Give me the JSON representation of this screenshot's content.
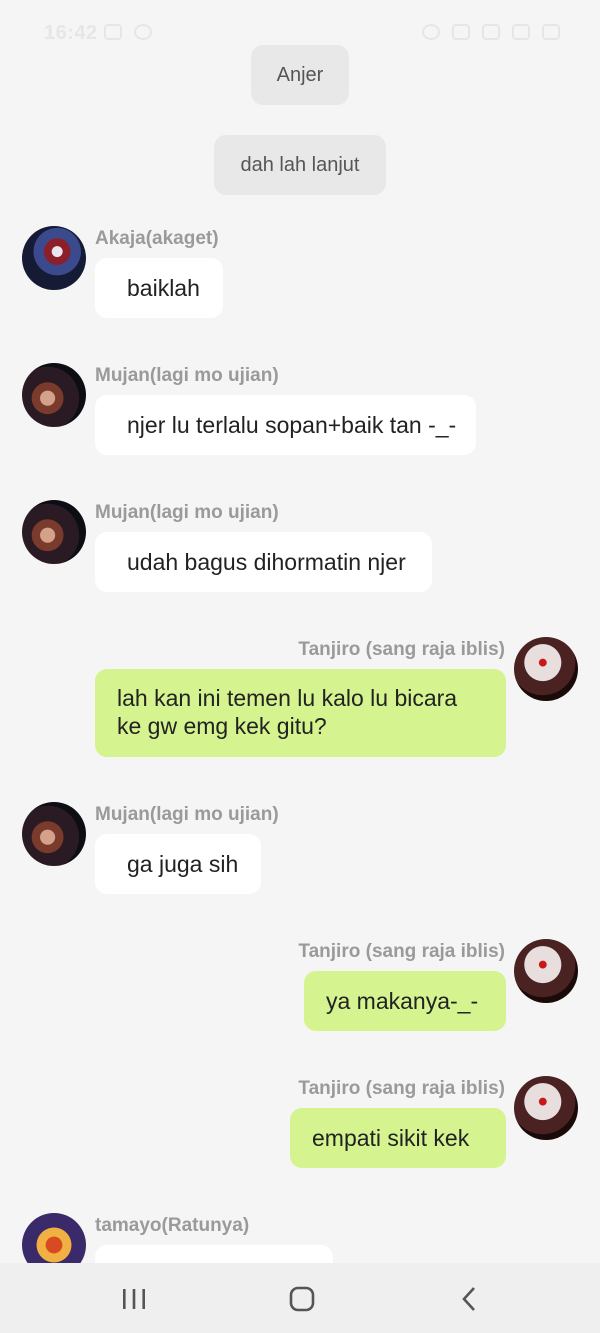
{
  "status_bar": {
    "time": "16:42"
  },
  "system_messages": [
    {
      "text": "Anjer"
    },
    {
      "text": "dah lah lanjut"
    }
  ],
  "messages": [
    {
      "sender": "Akaja(akaget)",
      "text": "baiklah",
      "direction": "in"
    },
    {
      "sender": "Mujan(lagi mo ujian)",
      "text": "njer lu terlalu sopan+baik tan -_-",
      "direction": "in"
    },
    {
      "sender": "Mujan(lagi mo ujian)",
      "text": "udah bagus dihormatin njer",
      "direction": "in"
    },
    {
      "sender": "Tanjiro (sang raja iblis)",
      "text": "lah kan ini temen lu kalo lu bicara ke gw emg kek gitu?",
      "direction": "out"
    },
    {
      "sender": "Mujan(lagi mo ujian)",
      "text": "ga juga sih",
      "direction": "in"
    },
    {
      "sender": "Tanjiro (sang raja iblis)",
      "text": "ya makanya-_-",
      "direction": "out"
    },
    {
      "sender": "Tanjiro (sang raja iblis)",
      "text": "empati sikit kek",
      "direction": "out"
    },
    {
      "sender": "tamayo(Ratunya)",
      "text": "",
      "direction": "in"
    }
  ],
  "colors": {
    "background": "#f5f5f5",
    "incoming_bubble": "#ffffff",
    "outgoing_bubble": "#d5f48f",
    "system_bubble": "#e8e8e8",
    "sender_name": "#9a9a9a"
  },
  "navigation_bar": {
    "recents_icon": "recents-icon",
    "home_icon": "home-icon",
    "back_icon": "back-icon"
  }
}
